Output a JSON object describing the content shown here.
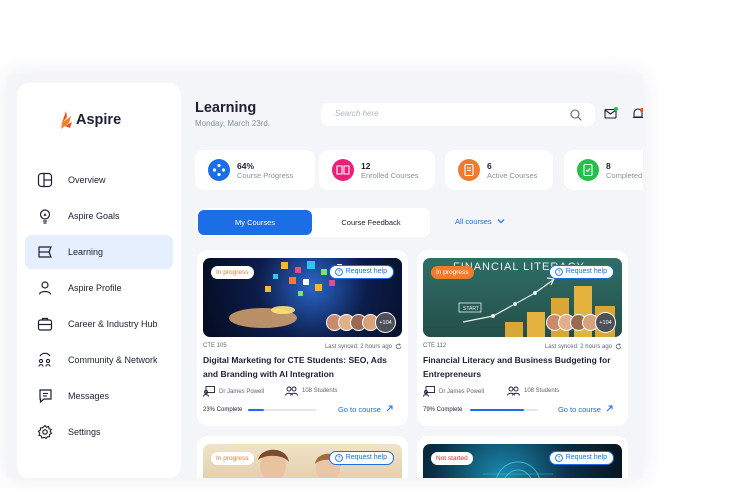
{
  "brand": {
    "name": "Aspire",
    "accent": "#1b6ee6"
  },
  "sidebar": {
    "items": [
      {
        "label": "Overview",
        "icon": "layout-icon"
      },
      {
        "label": "Aspire Goals",
        "icon": "lightbulb-icon"
      },
      {
        "label": "Learning",
        "icon": "book-icon",
        "active": true
      },
      {
        "label": "Aspire Profile",
        "icon": "user-icon"
      },
      {
        "label": "Career & Industry Hub",
        "icon": "briefcase-icon"
      },
      {
        "label": "Community & Network",
        "icon": "community-icon"
      },
      {
        "label": "Messages",
        "icon": "chat-icon"
      },
      {
        "label": "Settings",
        "icon": "gear-icon"
      }
    ]
  },
  "header": {
    "title": "Learning",
    "date": "Monday, March 23rd."
  },
  "search": {
    "placeholder": "Search here"
  },
  "stats": [
    {
      "value": "64%",
      "label": "Course Progress",
      "color": "#1b6ee6"
    },
    {
      "value": "12",
      "label": "Enrolled Courses",
      "color": "#ec1e79"
    },
    {
      "value": "6",
      "label": "Active Courses",
      "color": "#f07a2d"
    },
    {
      "value": "8",
      "label": "Completed",
      "color": "#25c04b"
    }
  ],
  "tabs": {
    "my_courses": "My Courses",
    "feedback": "Course Feedback"
  },
  "filter": "All courses",
  "help_label": "Request help",
  "courses": [
    {
      "status": "In progress",
      "code": "CTE 105",
      "synced": "Last synced: 2 hours ago",
      "title": "Digital Marketing for CTE Students: SEO, Ads and Branding with AI Integration",
      "instructor": "Dr James Powell",
      "students": "108 Students",
      "more": "+104",
      "progress": 0.23,
      "progress_label": "23% Complete",
      "action": "Go to course"
    },
    {
      "status": "In progress",
      "code": "CTE 112",
      "synced": "Last synced: 2 hours ago",
      "title": "Financial Literacy and Business Budgeting for Entrepreneurs",
      "instructor": "Dr James Powell",
      "students": "108 Students",
      "more": "+104",
      "progress": 0.79,
      "progress_label": "79% Complete",
      "action": "Go to course",
      "image_text": "FINANCIAL LITERACY",
      "image_start": "START"
    },
    {
      "status": "In progress"
    },
    {
      "status": "Not started"
    }
  ]
}
